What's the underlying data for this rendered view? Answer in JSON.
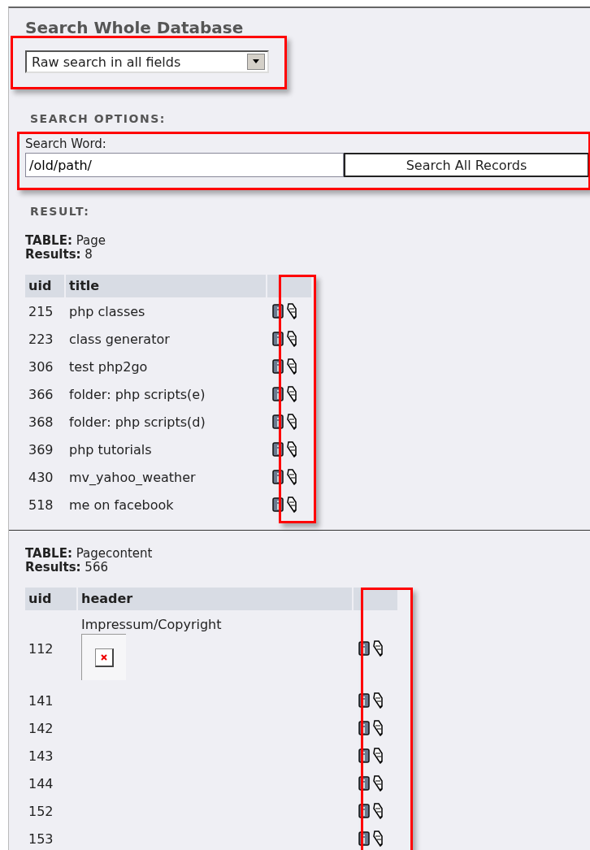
{
  "heading": "Search Whole Database",
  "search_mode": {
    "value": "Raw search in all fields",
    "highlighted": true
  },
  "search_options_label": "SEARCH OPTIONS:",
  "search_word": {
    "label": "Search Word:",
    "value": "/old/path/",
    "highlighted": true
  },
  "search_button": "Search All Records",
  "result_label": "RESULT:",
  "tables": [
    {
      "label": "TABLE:",
      "name": "Page",
      "results_label": "Results:",
      "count": "8",
      "columns": [
        "uid",
        "title"
      ],
      "actions_highlighted": true,
      "rows": [
        {
          "uid": "215",
          "text": "php classes",
          "kind": "plain"
        },
        {
          "uid": "223",
          "text": "class generator",
          "kind": "plain"
        },
        {
          "uid": "306",
          "text": "test php2go",
          "kind": "plain"
        },
        {
          "uid": "366",
          "text": "folder: php scripts(e)",
          "kind": "plain"
        },
        {
          "uid": "368",
          "text": "folder: php scripts(d)",
          "kind": "plain"
        },
        {
          "uid": "369",
          "text": "php tutorials",
          "kind": "plain"
        },
        {
          "uid": "430",
          "text": "mv_yahoo_weather",
          "kind": "plain"
        },
        {
          "uid": "518",
          "text": "me on facebook",
          "kind": "plain"
        }
      ]
    },
    {
      "label": "TABLE:",
      "name": "Pagecontent",
      "results_label": "Results:",
      "count": "566",
      "columns": [
        "uid",
        "header"
      ],
      "actions_highlighted": true,
      "rows": [
        {
          "uid": "112",
          "text": "Impressum/Copyright",
          "kind": "broken_image"
        },
        {
          "uid": "141",
          "kind": "plain"
        },
        {
          "uid": "142",
          "kind": "plain"
        },
        {
          "uid": "143",
          "kind": "plain"
        },
        {
          "uid": "144",
          "kind": "plain"
        },
        {
          "uid": "152",
          "kind": "plain"
        },
        {
          "uid": "153",
          "kind": "plain"
        }
      ]
    }
  ]
}
